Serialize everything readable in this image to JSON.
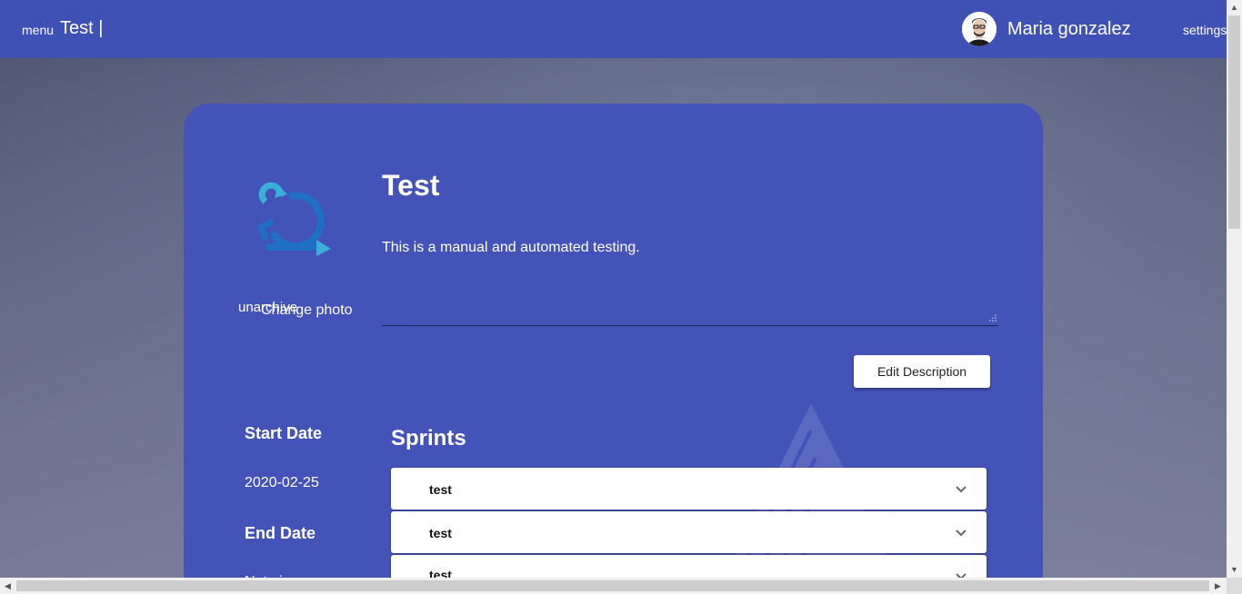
{
  "header": {
    "menu_label": "menu",
    "app_title": "Test |",
    "user_name": "Maria gonzalez",
    "settings_label": "settings"
  },
  "project": {
    "title": "Test",
    "description": "This is a manual and automated testing.",
    "unarchive_label": "unarchive",
    "change_photo_label": "Change photo",
    "edit_description_label": "Edit Description",
    "start_date_label": "Start Date",
    "start_date_value": "2020-02-25",
    "end_date_label": "End Date",
    "end_date_value": "Not given"
  },
  "sprints": {
    "title": "Sprints",
    "items": [
      {
        "label": "test"
      },
      {
        "label": "test"
      },
      {
        "label": "test"
      }
    ]
  },
  "colors": {
    "header_bg": "#3f51b5",
    "card_bg": "#4453b8",
    "logo_dark": "#1f6fc7",
    "logo_light": "#3ab0d8"
  }
}
